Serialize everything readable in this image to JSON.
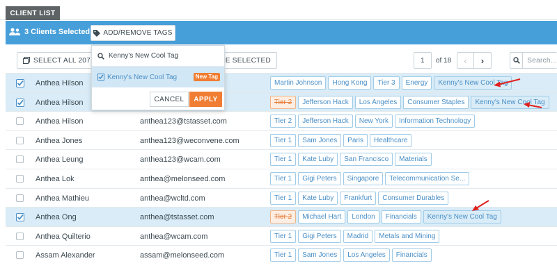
{
  "tabs": [
    {
      "label": "CLIENT LIST"
    }
  ],
  "toolbar": {
    "selected_label": "3 Clients Selected",
    "tag_button_label": "ADD/REMOVE TAGS",
    "select_all_label": "SELECT ALL 207 C",
    "delete_selected_label": "ETE SELECTED",
    "page_number": "1",
    "page_of": "of 18",
    "search_placeholder": "Search..."
  },
  "tag_dropdown": {
    "input_value": "Kenny's New Cool Tag",
    "option_label": "Kenny's New Cool Tag",
    "option_badge": "New Tag",
    "cancel_label": "CANCEL",
    "apply_label": "APPLY"
  },
  "rows": [
    {
      "selected": true,
      "name": "Anthea Hilson",
      "email": "",
      "tags": [
        {
          "text": "Martin Johnson"
        },
        {
          "text": "Hong Kong"
        },
        {
          "text": "Tier 3"
        },
        {
          "text": "Energy"
        },
        {
          "text": "Kenny's New Cool Tag",
          "new": true
        }
      ]
    },
    {
      "selected": true,
      "name": "Anthea Hilson",
      "email": "",
      "tags": [
        {
          "text": "Tier 2",
          "strike": true
        },
        {
          "text": "Jefferson Hack"
        },
        {
          "text": "Los Angeles"
        },
        {
          "text": "Consumer Staples"
        },
        {
          "text": "Kenny's New Cool Tag",
          "new": true
        }
      ]
    },
    {
      "selected": false,
      "name": "Anthea Hilson",
      "email": "anthea123@tstasset.com",
      "tags": [
        {
          "text": "Tier 2"
        },
        {
          "text": "Jefferson Hack"
        },
        {
          "text": "New York"
        },
        {
          "text": "Information Technology"
        }
      ]
    },
    {
      "selected": false,
      "name": "Anthea Jones",
      "email": "anthea123@weconvene.com",
      "tags": [
        {
          "text": "Tier 1"
        },
        {
          "text": "Sam Jones"
        },
        {
          "text": "Paris"
        },
        {
          "text": "Healthcare"
        }
      ]
    },
    {
      "selected": false,
      "name": "Anthea Leung",
      "email": "anthea123@wcam.com",
      "tags": [
        {
          "text": "Tier 1"
        },
        {
          "text": "Kate Luby"
        },
        {
          "text": "San Francisco"
        },
        {
          "text": "Materials"
        }
      ]
    },
    {
      "selected": false,
      "name": "Anthea Lok",
      "email": "anthea@melonseed.com",
      "tags": [
        {
          "text": "Tier 1"
        },
        {
          "text": "Gigi Peters"
        },
        {
          "text": "Singapore"
        },
        {
          "text": "Telecommunication Se..."
        }
      ]
    },
    {
      "selected": false,
      "name": "Anthea Mathieu",
      "email": "anthea@wcltd.com",
      "tags": [
        {
          "text": "Tier 1"
        },
        {
          "text": "Kate Luby"
        },
        {
          "text": "Frankfurt"
        },
        {
          "text": "Consumer Durables"
        }
      ]
    },
    {
      "selected": true,
      "name": "Anthea Ong",
      "email": "anthea@tstasset.com",
      "tags": [
        {
          "text": "Tier 2",
          "strike": true
        },
        {
          "text": "Michael Hart"
        },
        {
          "text": "London"
        },
        {
          "text": "Financials"
        },
        {
          "text": "Kenny's New Cool Tag",
          "new": true
        }
      ]
    },
    {
      "selected": false,
      "name": "Anthea Quilterio",
      "email": "anthea@wcam.com",
      "tags": [
        {
          "text": "Tier 1"
        },
        {
          "text": "Gigi Peters"
        },
        {
          "text": "Madrid"
        },
        {
          "text": "Metals and Mining"
        }
      ]
    },
    {
      "selected": false,
      "name": "Assam Alexander",
      "email": "assam@melonseed.com",
      "tags": [
        {
          "text": "Tier 1"
        },
        {
          "text": "Sam Jones"
        },
        {
          "text": "Los Angeles"
        },
        {
          "text": "Financials"
        }
      ]
    }
  ],
  "colors": {
    "accent": "#479fda",
    "apply": "#f07d31",
    "selected_row": "#d9ecf7",
    "arrow": "#e0201e"
  }
}
